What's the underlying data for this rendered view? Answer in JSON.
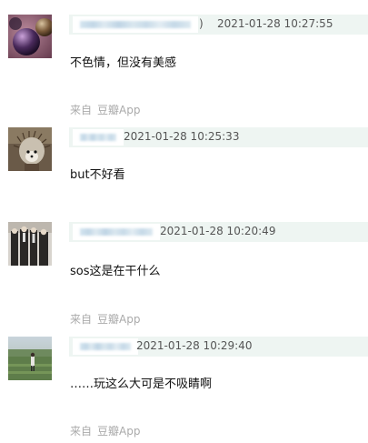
{
  "comments": [
    {
      "timestamp": "2021-01-28 10:27:55",
      "text": "不色情，但没有美感",
      "source_prefix": "来自",
      "source_app": "豆瓣App",
      "name_fragment": ")"
    },
    {
      "timestamp": "2021-01-28 10:25:33",
      "text": "but不好看"
    },
    {
      "timestamp": "2021-01-28 10:20:49",
      "text": "sos这是在干什么",
      "source_prefix": "来自",
      "source_app": "豆瓣App"
    },
    {
      "timestamp": "2021-01-28 10:29:40",
      "text": "……玩这么大可是不吸睛啊",
      "source_prefix": "来自",
      "source_app": "豆瓣App"
    }
  ]
}
